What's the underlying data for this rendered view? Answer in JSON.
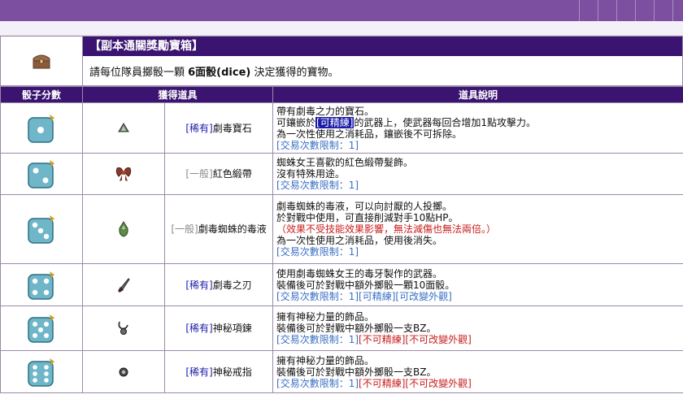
{
  "header": {
    "title": "【副本通關獎勵寶箱】",
    "subtitle_pre": "請每位隊員擲骰一顆 ",
    "subtitle_bold": "6面骰(dice)",
    "subtitle_post": " 決定獲得的寶物。"
  },
  "columns": [
    "骰子分數",
    "獲得道具",
    "道具說明"
  ],
  "rows": [
    {
      "dice": 1,
      "grade": "[稀有]",
      "grade_type": "rare",
      "name": "劇毒寶石",
      "desc": [
        "帶有劇毒之力的寶石。",
        "可鑲嵌於",
        "[可精練]",
        "的武器上，使武器每回合增加1點攻擊力。",
        "為一次性使用之消耗品，鑲嵌後不可拆除。"
      ],
      "limit": "[交易次數限制：1]"
    },
    {
      "dice": 2,
      "grade": "[一般]",
      "grade_type": "normal",
      "name": "紅色緞帶",
      "desc": [
        "蜘蛛女王喜歡的紅色緞帶髮飾。",
        "沒有特殊用途。"
      ],
      "limit": "[交易次數限制：1]"
    },
    {
      "dice": 3,
      "grade": "[一般]",
      "grade_type": "normal",
      "name": "劇毒蜘蛛的毒液",
      "desc": [
        "劇毒蜘蛛的毒液，可以向討厭的人投擲。",
        "於對戰中使用，可直接削減對手10點HP。",
        "（效果不受技能效果影響，無法減傷也無法兩倍。）",
        "為一次性使用之消耗品，使用後消失。"
      ],
      "limit": "[交易次數限制：1]"
    },
    {
      "dice": 4,
      "grade": "[稀有]",
      "grade_type": "rare",
      "name": "劇毒之刃",
      "desc": [
        "使用劇毒蜘蛛女王的毒牙製作的武器。",
        "裝備後可於對戰中額外擲骰一顆10面骰。"
      ],
      "limit": "[交易次數限制：1]",
      "tags": [
        "[可精練]",
        "[可改變外觀]"
      ]
    },
    {
      "dice": 5,
      "grade": "[稀有]",
      "grade_type": "rare",
      "name": "神秘項鍊",
      "desc": [
        "擁有神秘力量的飾品。",
        "裝備後可於對戰中額外擲骰一支BZ。"
      ],
      "limit": "[交易次數限制：1]",
      "tags_red": [
        "[不可精練]",
        "[不可改變外觀]"
      ]
    },
    {
      "dice": 6,
      "grade": "[稀有]",
      "grade_type": "rare",
      "name": "神秘戒指",
      "desc": [
        "擁有神秘力量的飾品。",
        "裝備後可於對戰中額外擲骰一支BZ。"
      ],
      "limit": "[交易次數限制：1]",
      "tags_red": [
        "[不可精練]",
        "[不可改變外觀]"
      ]
    }
  ],
  "colors": {
    "top_bar": "#7c4fa1",
    "header_bg": "#3a1470",
    "rare": "#1a1aa8",
    "normal": "#8a8a8a",
    "limit": "#3a6fc4",
    "warning": "#c81e1e",
    "dice_face": "#6fb6c9"
  },
  "icons": {
    "chest": "treasure-chest-icon",
    "dice": "dice-icon",
    "items": [
      "poison-gem-icon",
      "red-ribbon-icon",
      "poison-vial-icon",
      "poison-blade-icon",
      "mystic-necklace-icon",
      "mystic-ring-icon"
    ]
  }
}
